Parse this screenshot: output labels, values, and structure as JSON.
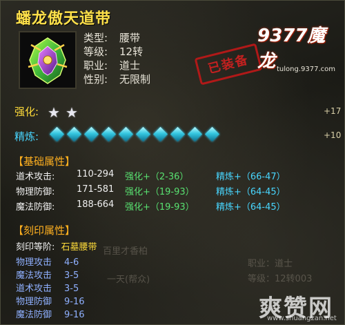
{
  "item": {
    "name": "蟠龙傲天道带",
    "type_label": "类型:",
    "type_value": "腰带",
    "level_label": "等级:",
    "level_value": "12转",
    "job_label": "职业:",
    "job_value": "道士",
    "gender_label": "性别:",
    "gender_value": "无限制",
    "icon": "belt-icon"
  },
  "logo": {
    "brand": "9377魔龙",
    "url": "tulong.9377.com"
  },
  "stamp": "已装备",
  "strengthen": {
    "label": "强化:",
    "stars": 2,
    "bonus": "+17"
  },
  "refine": {
    "label": "精炼:",
    "gems": 10,
    "bonus": "+10"
  },
  "base_section": {
    "title": "【基础属性】"
  },
  "base_stats": [
    {
      "name": "道术攻击:",
      "value": "110-294",
      "strengthen": "强化+（2-36）",
      "refine": "精炼+（66-47）"
    },
    {
      "name": "物理防御:",
      "value": "171-581",
      "strengthen": "强化+（19-93）",
      "refine": "精炼+（64-45）"
    },
    {
      "name": "魔法防御:",
      "value": "188-664",
      "strengthen": "强化+（19-93）",
      "refine": "精炼+（64-45）"
    }
  ],
  "engrave_section": {
    "title": "【刻印属性】"
  },
  "engrave_level": {
    "label": "刻印等阶:",
    "value": "石墓腰带"
  },
  "engrave_stats": [
    {
      "name": "物理攻击",
      "value": "4-6"
    },
    {
      "name": "魔法攻击",
      "value": "3-5"
    },
    {
      "name": "道术攻击",
      "value": "3-5"
    },
    {
      "name": "物理防御",
      "value": "9-16"
    },
    {
      "name": "魔法防御",
      "value": "9-16"
    }
  ],
  "background": {
    "text_1": "百里才香柏",
    "text_2": "一天(帮众)",
    "text_3": "职业：道士",
    "text_4": "等级：12转003"
  },
  "watermark": {
    "main": "爽赞网",
    "url": "www.shuangzan.net"
  },
  "colors": {
    "title": "#ffe14a",
    "section": "#ffb020",
    "strengthen": "#58e070",
    "refine": "#48d6ff",
    "engrave": "#8fb0ff"
  }
}
